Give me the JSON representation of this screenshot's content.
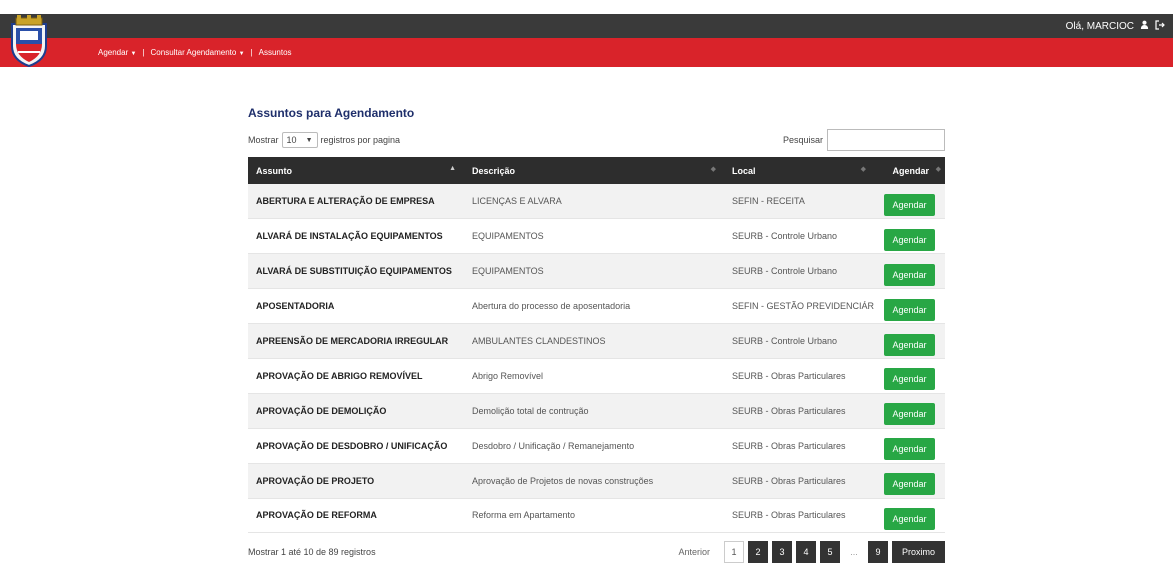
{
  "header": {
    "user_greeting": "Olá, MARCIOC",
    "user_icon": "user-icon",
    "logout_icon": "logout-icon"
  },
  "nav": {
    "agendar": "Agendar",
    "consultar": "Consultar Agendamento",
    "assuntos": "Assuntos",
    "separator": "|"
  },
  "page": {
    "title": "Assuntos para Agendamento",
    "show_prefix": "Mostrar",
    "per_page_value": "10",
    "show_suffix": "registros por pagina",
    "search_label": "Pesquisar",
    "search_value": ""
  },
  "table": {
    "headers": [
      "Assunto",
      "Descrição",
      "Local",
      "Agendar"
    ],
    "button_label": "Agendar",
    "rows": [
      {
        "assunto": "ABERTURA E ALTERAÇÃO DE EMPRESA",
        "descricao": "LICENÇAS E ALVARA",
        "local": "SEFIN - RECEITA"
      },
      {
        "assunto": "ALVARÁ DE INSTALAÇÃO EQUIPAMENTOS",
        "descricao": "EQUIPAMENTOS",
        "local": "SEURB - Controle Urbano"
      },
      {
        "assunto": "ALVARÁ DE SUBSTITUIÇÃO EQUIPAMENTOS",
        "descricao": "EQUIPAMENTOS",
        "local": "SEURB - Controle Urbano"
      },
      {
        "assunto": "APOSENTADORIA",
        "descricao": "Abertura do processo de aposentadoria",
        "local": "SEFIN - GESTÃO PREVIDENCIÁRIA"
      },
      {
        "assunto": "APREENSÃO DE MERCADORIA IRREGULAR",
        "descricao": "AMBULANTES CLANDESTINOS",
        "local": "SEURB - Controle Urbano"
      },
      {
        "assunto": "APROVAÇÃO DE ABRIGO REMOVÍVEL",
        "descricao": "Abrigo Removível",
        "local": "SEURB - Obras Particulares"
      },
      {
        "assunto": "APROVAÇÃO DE DEMOLIÇÃO",
        "descricao": "Demolição total de contrução",
        "local": "SEURB - Obras Particulares"
      },
      {
        "assunto": "APROVAÇÃO DE DESDOBRO / UNIFICAÇÃO",
        "descricao": "Desdobro / Unificação / Remanejamento",
        "local": "SEURB - Obras Particulares"
      },
      {
        "assunto": "APROVAÇÃO DE PROJETO",
        "descricao": "Aprovação de Projetos de novas construções",
        "local": "SEURB - Obras Particulares"
      },
      {
        "assunto": "APROVAÇÃO DE REFORMA",
        "descricao": "Reforma em Apartamento",
        "local": "SEURB - Obras Particulares"
      }
    ]
  },
  "footer": {
    "info": "Mostrar 1 até 10 de 89 registros",
    "prev": "Anterior",
    "pages": [
      "1",
      "2",
      "3",
      "4",
      "5"
    ],
    "current_page": "1",
    "ellipsis": "...",
    "last": "9",
    "next": "Proximo"
  },
  "colors": {
    "topbar": "#3a3a3a",
    "navbar": "#d9232a",
    "button": "#28a745",
    "table_header": "#2d2d2d"
  }
}
